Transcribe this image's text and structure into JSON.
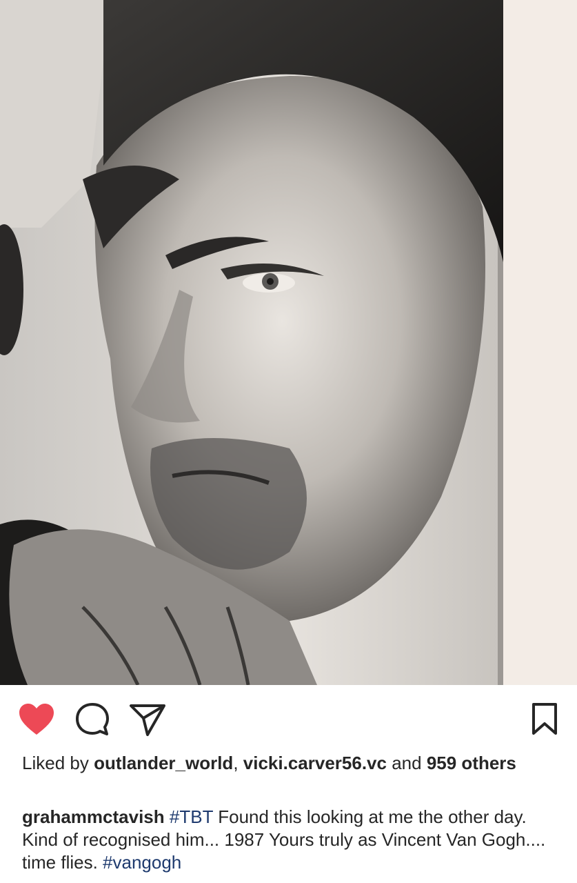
{
  "post": {
    "image_alt": "Black and white portrait photograph",
    "liked": true,
    "colors": {
      "like_active": "#ed4956",
      "hashtag": "#1e3a6e",
      "text": "#262626"
    },
    "icons": {
      "like": "heart-icon",
      "comment": "speech-bubble-icon",
      "share": "paper-plane-icon",
      "save": "bookmark-icon"
    },
    "likes": {
      "prefix": "Liked by ",
      "user1": "outlander_world",
      "separator": ", ",
      "user2": "vicki.carver56.vc",
      "middle": " and ",
      "others": "959 others"
    },
    "caption": {
      "username": "grahammctavish",
      "hashtag1": "#TBT",
      "text": " Found this looking at me the other day. Kind of recognised him... 1987 Yours truly as Vincent Van Gogh.... time flies. ",
      "hashtag2": "#vangogh"
    }
  }
}
